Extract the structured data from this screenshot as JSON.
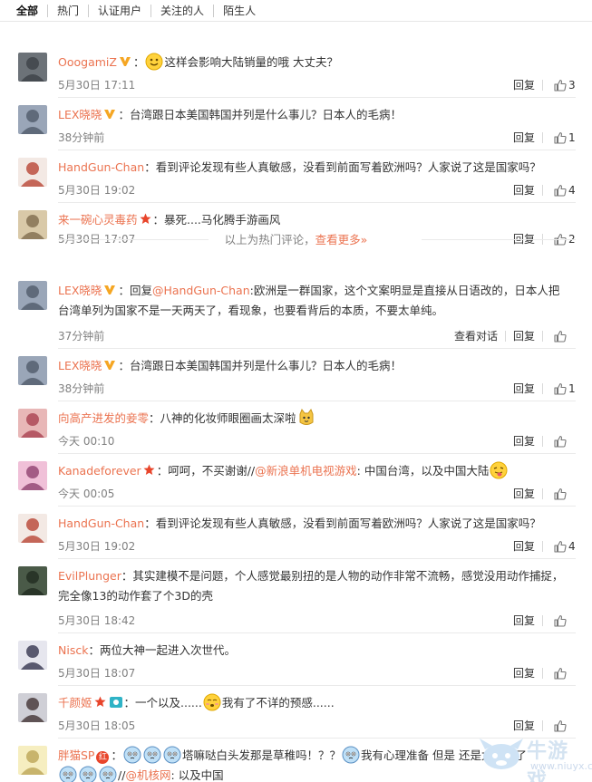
{
  "tabs": [
    "全部",
    "热门",
    "认证用户",
    "关注的人",
    "陌生人"
  ],
  "actions": {
    "reply": "回复",
    "view_conversation": "查看对话"
  },
  "hot_separator": {
    "text": "以上为热门评论，",
    "more": "查看更多»"
  },
  "comments": [
    {
      "name": "OoogamiZ",
      "badges": [
        "verified-v"
      ],
      "pre_emoji": "smile",
      "text": "：",
      "text2": "这样会影响大陆销量的哦 大丈夫？",
      "time": "5月30日 17:11",
      "likes": "3"
    },
    {
      "name": "LEX晓晓",
      "badges": [
        "verified-v"
      ],
      "text": "：台湾跟日本美国韩国并列是什么事儿？日本人的毛病！",
      "time": "38分钟前",
      "likes": "1"
    },
    {
      "name": "HandGun-Chan",
      "badges": [],
      "text": "：看到评论发现有些人真敏感，没看到前面写着欧洲吗？人家说了这是国家吗？",
      "time": "5月30日 19:02",
      "likes": "4"
    },
    {
      "name": "来一碗心灵毒药",
      "badges": [
        "star"
      ],
      "text": "：暴死....马化腾手游画风",
      "time": "5月30日 17:07",
      "likes": "2"
    },
    {
      "name": "LEX晓晓",
      "badges": [
        "verified-v"
      ],
      "text": "：回复",
      "at": "@HandGun-Chan",
      "text2": ":欧洲是一群国家，这个文案明显是直接从日语改的，日本人把",
      "line2": "台湾单列为国家不是一天两天了，看现象，也要看背后的本质，不要太单纯。",
      "time": "37分钟前",
      "likes": "",
      "conv": true
    },
    {
      "name": "LEX晓晓",
      "badges": [
        "verified-v"
      ],
      "text": "：台湾跟日本美国韩国并列是什么事儿？日本人的毛病！",
      "time": "38分钟前",
      "likes": "1"
    },
    {
      "name": "向高产进发的妾零",
      "badges": [],
      "text": "：八神的化妆师眼圈画太深啦",
      "post_emoji": "cat",
      "time": "今天 00:10",
      "likes": ""
    },
    {
      "name": "Kanadeforever",
      "badges": [
        "star"
      ],
      "text": "：呵呵，不买谢谢//",
      "at": "@新浪单机电视游戏",
      "text2": ": 中国台湾，以及中国大陆",
      "post_emoji": "tongue",
      "time": "今天 00:05",
      "likes": ""
    },
    {
      "name": "HandGun-Chan",
      "badges": [],
      "text": "：看到评论发现有些人真敏感，没看到前面写着欧洲吗？人家说了这是国家吗？",
      "time": "5月30日 19:02",
      "likes": "4"
    },
    {
      "name": "EvilPlunger",
      "badges": [],
      "text": "：其实建模不是问题，个人感觉最别扭的是人物的动作非常不流畅，感觉没用动作捕捉，",
      "line2": "完全像13的动作套了个3D的壳",
      "time": "5月30日 18:42",
      "likes": ""
    },
    {
      "name": "Nisck",
      "badges": [],
      "text": "：两位大神一起进入次世代。",
      "time": "5月30日 18:07",
      "likes": ""
    },
    {
      "name": "千颜姬",
      "badges": [
        "star",
        "camera"
      ],
      "text": "：一个以及......",
      "post_emoji": "shy",
      "text3": "我有了不详的预感......",
      "time": "5月30日 18:05",
      "likes": ""
    },
    {
      "name": "胖猫SP",
      "badges": [
        "red"
      ],
      "badge_red_text": "红",
      "text": "：",
      "line1_emojis": 3,
      "text2": "塔嘛哒白头发那是草稚吗！？？",
      "mid_emoji": 1,
      "text3": "我有心理准备 但是 还是太突然了",
      "line2_emojis": 3,
      "line2_text": "//",
      "at2": "@机核网",
      "line2_tail": ": 以及中国",
      "time": "5月30日 17:54",
      "likes": ""
    }
  ],
  "watermark": {
    "text": "牛游戏",
    "url": "www.niuyx.com"
  }
}
